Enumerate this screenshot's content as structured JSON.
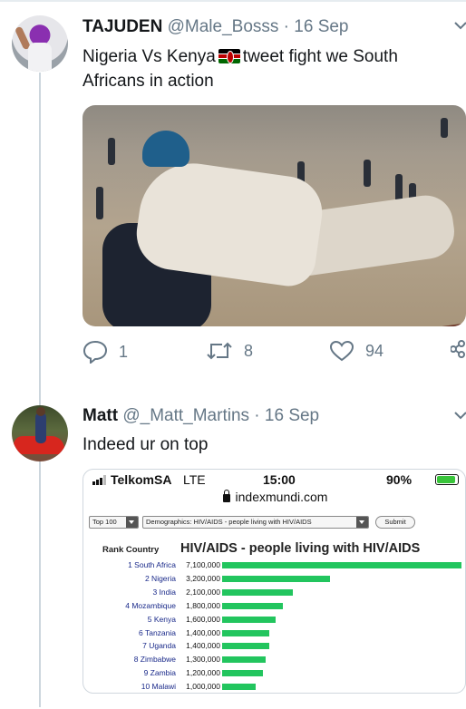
{
  "tweets": [
    {
      "name": "TAJUDEN",
      "handle": "@Male_Bosss",
      "date": "16 Sep",
      "text_before_flag": "Nigeria Vs Kenya",
      "text_after_flag": "tweet fight we South Africans in action",
      "replies": "1",
      "retweets": "8",
      "likes": "94"
    },
    {
      "name": "Matt",
      "handle": "@_Matt_Martins",
      "date": "16 Sep",
      "text": "Indeed ur on top"
    }
  ],
  "icons": [
    "chevron-down-icon",
    "reply-icon",
    "retweet-icon",
    "like-icon",
    "share-icon",
    "kenya-flag-icon",
    "lock-icon",
    "signal-bars-icon",
    "battery-icon"
  ],
  "embedded_screenshot": {
    "carrier": "TelkomSA",
    "network": "LTE",
    "time": "15:00",
    "battery": "90%",
    "url": "indexmundi.com",
    "top_select": "Top 100",
    "demographics_select": "Demographics: HIV/AIDS - people living with HIV/AIDS",
    "submit_label": "Submit",
    "rank_country_header": "Rank Country",
    "table_title": "HIV/AIDS - people living with HIV/AIDS",
    "rows": [
      {
        "rank": "1",
        "country": "South Africa",
        "value_label": "7,100,000",
        "value": 7100000
      },
      {
        "rank": "2",
        "country": "Nigeria",
        "value_label": "3,200,000",
        "value": 3200000
      },
      {
        "rank": "3",
        "country": "India",
        "value_label": "2,100,000",
        "value": 2100000
      },
      {
        "rank": "4",
        "country": "Mozambique",
        "value_label": "1,800,000",
        "value": 1800000
      },
      {
        "rank": "5",
        "country": "Kenya",
        "value_label": "1,600,000",
        "value": 1600000
      },
      {
        "rank": "6",
        "country": "Tanzania",
        "value_label": "1,400,000",
        "value": 1400000
      },
      {
        "rank": "7",
        "country": "Uganda",
        "value_label": "1,400,000",
        "value": 1400000
      },
      {
        "rank": "8",
        "country": "Zimbabwe",
        "value_label": "1,300,000",
        "value": 1300000
      },
      {
        "rank": "9",
        "country": "Zambia",
        "value_label": "1,200,000",
        "value": 1200000
      },
      {
        "rank": "10",
        "country": "Malawi",
        "value_label": "1,000,000",
        "value": 1000000
      }
    ]
  },
  "colors": {
    "bar": "#22c55e",
    "handle": "#657786",
    "link_country": "#1a2a8a"
  }
}
